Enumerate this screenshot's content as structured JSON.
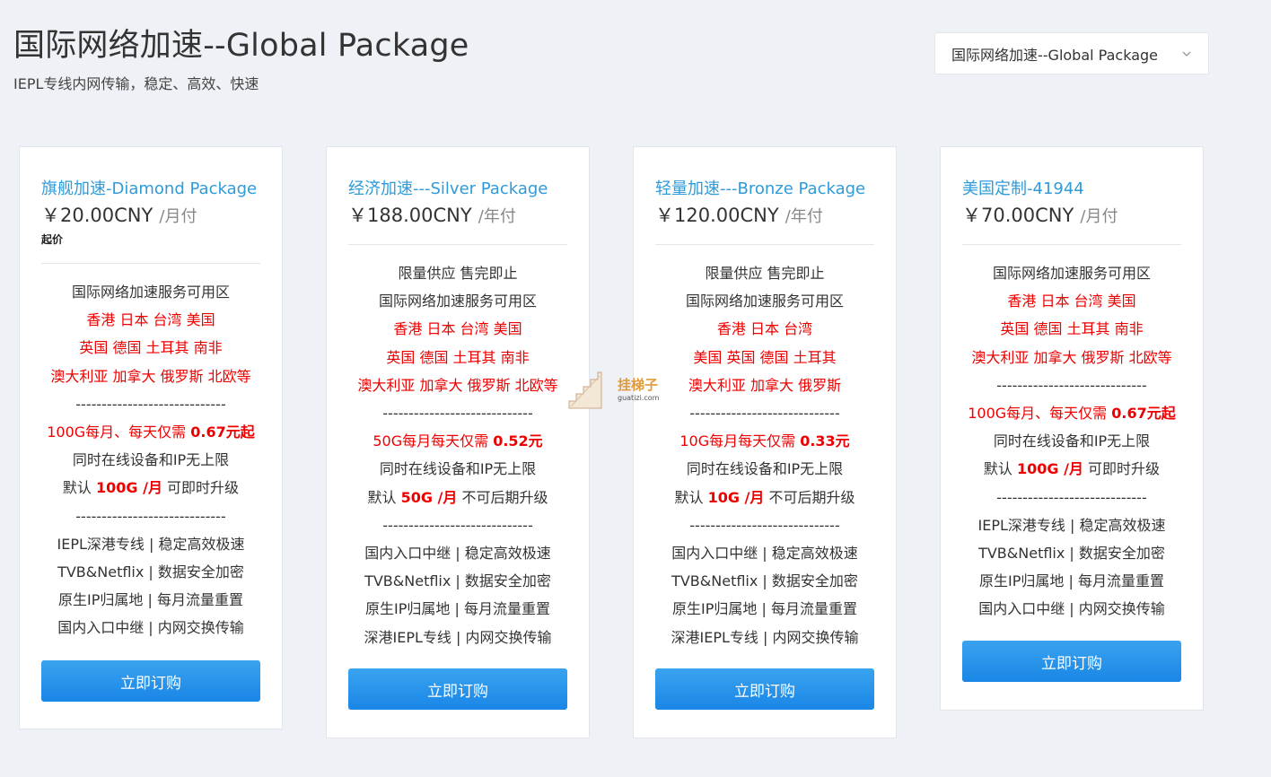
{
  "header": {
    "title": "国际网络加速--Global Package",
    "subtitle": "IEPL专线内网传输，稳定、高效、快速"
  },
  "group_select": {
    "selected": "国际网络加速--Global Package"
  },
  "watermark": {
    "cn": "挂梯子",
    "en": "guatizi.com"
  },
  "cards": [
    {
      "name": "旗舰加速-Diamond Package",
      "price": "￥20.00CNY",
      "cycle": "/月付",
      "starting": "起价",
      "btn": "立即订购",
      "lines": [
        [
          {
            "t": "国际网络加速服务可用区"
          }
        ],
        [
          {
            "t": "香港 日本 台湾 美国",
            "c": "red"
          }
        ],
        [
          {
            "t": "英国 德国 土耳其 南非",
            "c": "red"
          }
        ],
        [
          {
            "t": "澳大利亚 加拿大 俄罗斯 北欧等",
            "c": "red"
          }
        ],
        [
          {
            "t": "-----------------------------"
          }
        ],
        [
          {
            "t": "100G每月、每天仅需 ",
            "c": "red"
          },
          {
            "t": "0.67元起",
            "c": "red bold"
          }
        ],
        [
          {
            "t": "同时在线设备和IP无上限"
          }
        ],
        [
          {
            "t": "默认 "
          },
          {
            "t": "100G /月",
            "c": "red bold"
          },
          {
            "t": "  可即时升级"
          }
        ],
        [
          {
            "t": "-----------------------------"
          }
        ],
        [
          {
            "t": "IEPL深港专线 | 稳定高效极速"
          }
        ],
        [
          {
            "t": "TVB&Netflix | 数据安全加密"
          }
        ],
        [
          {
            "t": "原生IP归属地 | 每月流量重置"
          }
        ],
        [
          {
            "t": "国内入口中继 | 内网交换传输"
          }
        ]
      ]
    },
    {
      "name": "经济加速---Silver Package",
      "price": "￥188.00CNY",
      "cycle": "/年付",
      "btn": "立即订购",
      "lines": [
        [
          {
            "t": "限量供应 售完即止"
          }
        ],
        [
          {
            "t": "国际网络加速服务可用区"
          }
        ],
        [
          {
            "t": "香港 日本 台湾 美国",
            "c": "red"
          }
        ],
        [
          {
            "t": "英国 德国 土耳其 南非",
            "c": "red"
          }
        ],
        [
          {
            "t": "澳大利亚 加拿大 俄罗斯 北欧等",
            "c": "red"
          }
        ],
        [
          {
            "t": "-----------------------------"
          }
        ],
        [
          {
            "t": "50G每月每天仅需 ",
            "c": "red"
          },
          {
            "t": "0.52元",
            "c": "red bold"
          }
        ],
        [
          {
            "t": "同时在线设备和IP无上限"
          }
        ],
        [
          {
            "t": "默认 "
          },
          {
            "t": "50G /月",
            "c": "red bold"
          },
          {
            "t": "  不可后期升级"
          }
        ],
        [
          {
            "t": "-----------------------------"
          }
        ],
        [
          {
            "t": "国内入口中继 | 稳定高效极速"
          }
        ],
        [
          {
            "t": "TVB&Netflix | 数据安全加密"
          }
        ],
        [
          {
            "t": "原生IP归属地 | 每月流量重置"
          }
        ],
        [
          {
            "t": "深港IEPL专线 | 内网交换传输"
          }
        ]
      ]
    },
    {
      "name": "轻量加速---Bronze Package",
      "price": "￥120.00CNY",
      "cycle": "/年付",
      "btn": "立即订购",
      "lines": [
        [
          {
            "t": "限量供应 售完即止"
          }
        ],
        [
          {
            "t": "国际网络加速服务可用区"
          }
        ],
        [
          {
            "t": "香港 日本 台湾",
            "c": "red"
          }
        ],
        [
          {
            "t": "美国 英国 德国 土耳其",
            "c": "red"
          }
        ],
        [
          {
            "t": "澳大利亚 加拿大 俄罗斯",
            "c": "red"
          }
        ],
        [
          {
            "t": "-----------------------------"
          }
        ],
        [
          {
            "t": "10G每月每天仅需 ",
            "c": "red"
          },
          {
            "t": "0.33元",
            "c": "red bold"
          }
        ],
        [
          {
            "t": "同时在线设备和IP无上限"
          }
        ],
        [
          {
            "t": "默认 "
          },
          {
            "t": "10G /月",
            "c": "red bold"
          },
          {
            "t": "  不可后期升级"
          }
        ],
        [
          {
            "t": "-----------------------------"
          }
        ],
        [
          {
            "t": "国内入口中继 | 稳定高效极速"
          }
        ],
        [
          {
            "t": "TVB&Netflix | 数据安全加密"
          }
        ],
        [
          {
            "t": "原生IP归属地 | 每月流量重置"
          }
        ],
        [
          {
            "t": "深港IEPL专线 | 内网交换传输"
          }
        ]
      ]
    },
    {
      "name": "美国定制-41944",
      "price": "￥70.00CNY",
      "cycle": "/月付",
      "btn": "立即订购",
      "lines": [
        [
          {
            "t": "国际网络加速服务可用区"
          }
        ],
        [
          {
            "t": "香港 日本 台湾 美国",
            "c": "red"
          }
        ],
        [
          {
            "t": "英国 德国 土耳其 南非",
            "c": "red"
          }
        ],
        [
          {
            "t": "澳大利亚 加拿大 俄罗斯 北欧等",
            "c": "red"
          }
        ],
        [
          {
            "t": "-----------------------------"
          }
        ],
        [
          {
            "t": "100G每月、每天仅需 ",
            "c": "red"
          },
          {
            "t": "0.67元起",
            "c": "red bold"
          }
        ],
        [
          {
            "t": "同时在线设备和IP无上限"
          }
        ],
        [
          {
            "t": "默认 "
          },
          {
            "t": "100G /月",
            "c": "red bold"
          },
          {
            "t": "  可即时升级"
          }
        ],
        [
          {
            "t": "-----------------------------"
          }
        ],
        [
          {
            "t": "IEPL深港专线 | 稳定高效极速"
          }
        ],
        [
          {
            "t": "TVB&Netflix | 数据安全加密"
          }
        ],
        [
          {
            "t": "原生IP归属地 | 每月流量重置"
          }
        ],
        [
          {
            "t": "国内入口中继 | 内网交换传输"
          }
        ]
      ]
    }
  ]
}
